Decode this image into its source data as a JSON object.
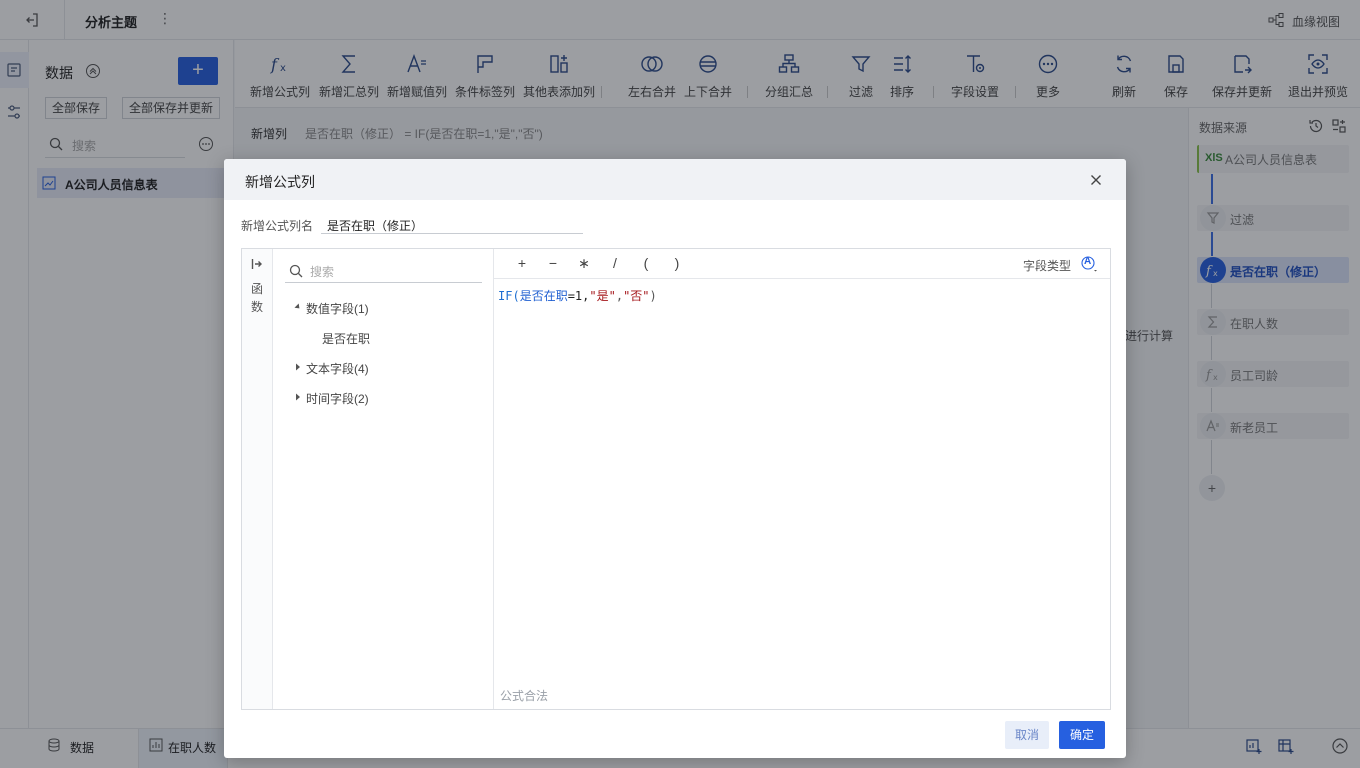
{
  "topbar": {
    "title": "分析主题",
    "more": "⋮",
    "lineage": "血缘视图"
  },
  "sidebar": {
    "header": "数据",
    "add": "+",
    "save_all": "全部保存",
    "save_all_update": "全部保存并更新",
    "search_placeholder": "搜索",
    "table": "A公司人员信息表"
  },
  "toolbar": {
    "items": [
      {
        "label": "新增公式列",
        "icon": "formula-icon"
      },
      {
        "label": "新增汇总列",
        "icon": "sigma-icon"
      },
      {
        "label": "新增赋值列",
        "icon": "assign-icon"
      },
      {
        "label": "条件标签列",
        "icon": "tag-icon"
      },
      {
        "label": "其他表添加列",
        "icon": "add-column-icon"
      },
      {
        "label": "左右合并",
        "icon": "merge-lr-icon"
      },
      {
        "label": "上下合并",
        "icon": "merge-ud-icon"
      },
      {
        "label": "分组汇总",
        "icon": "group-icon"
      },
      {
        "label": "过滤",
        "icon": "filter-icon"
      },
      {
        "label": "排序",
        "icon": "sort-icon"
      },
      {
        "label": "字段设置",
        "icon": "field-settings-icon"
      },
      {
        "label": "更多",
        "icon": "more-icon"
      },
      {
        "label": "刷新",
        "icon": "refresh-icon"
      },
      {
        "label": "保存",
        "icon": "save-icon"
      },
      {
        "label": "保存并更新",
        "icon": "save-update-icon"
      },
      {
        "label": "退出并预览",
        "icon": "preview-icon"
      }
    ]
  },
  "formulabar": {
    "label": "新增列",
    "formula": "是否在职（修正） = IF(是否在职=1,\"是\",\"否\")"
  },
  "canvas_hint": "进行计算",
  "rightpanel": {
    "header": "数据来源",
    "source_badge": "XlS",
    "steps": [
      {
        "label": "A公司人员信息表"
      },
      {
        "label": "过滤"
      },
      {
        "label": "是否在职（修正）"
      },
      {
        "label": "在职人数"
      },
      {
        "label": "员工司龄"
      },
      {
        "label": "新老员工"
      }
    ],
    "add": "+"
  },
  "bottombar": {
    "tab_data": "数据",
    "tab_active": "在职人数"
  },
  "modal": {
    "title": "新增公式列",
    "name_label": "新增公式列名",
    "name_value": "是否在职（修正）",
    "fn_label": "函数",
    "search_placeholder": "搜索",
    "tree": {
      "numeric": "数值字段(1)",
      "numeric_child": "是否在职",
      "text": "文本字段(4)",
      "time": "时间字段(2)"
    },
    "operators": [
      "+",
      "−",
      "∗",
      "/",
      "(",
      ")"
    ],
    "field_type_label": "字段类型",
    "field_type_badge": "A",
    "code": {
      "fn": "IF(",
      "field": "是否在职",
      "cmp": "=1,",
      "s1": "\"是\"",
      "comma": ",",
      "s2": "\"否\"",
      "close": ")"
    },
    "validity": "公式合法",
    "cancel": "取消",
    "ok": "确定"
  },
  "colors": {
    "primary": "#2660e0",
    "primary_light": "#dce6fb",
    "string": "#a4161a",
    "field": "#1f5fd1"
  }
}
